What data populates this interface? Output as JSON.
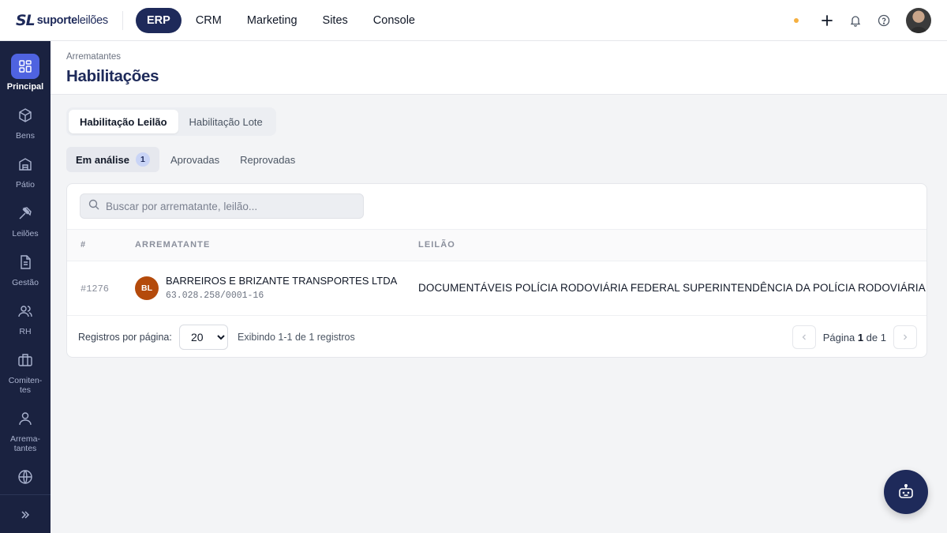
{
  "app": {
    "logo_mark": "SL",
    "logo_bold": "suporte",
    "logo_rest": "leilões"
  },
  "topnav": {
    "items": [
      {
        "label": "ERP",
        "active": true
      },
      {
        "label": "CRM"
      },
      {
        "label": "Marketing"
      },
      {
        "label": "Sites"
      },
      {
        "label": "Console"
      }
    ]
  },
  "sidebar": {
    "items": [
      {
        "label": "Principal",
        "icon": "grid-icon",
        "active": true
      },
      {
        "label": "Bens",
        "icon": "box-icon"
      },
      {
        "label": "Pátio",
        "icon": "warehouse-icon"
      },
      {
        "label": "Leilões",
        "icon": "gavel-icon"
      },
      {
        "label": "Gestão",
        "icon": "document-icon"
      },
      {
        "label": "RH",
        "icon": "users-icon"
      },
      {
        "label": "Comiten-\ntes",
        "icon": "briefcase-icon"
      },
      {
        "label": "Arrema-\ntantes",
        "icon": "user-icon"
      },
      {
        "label": "",
        "icon": "globe-icon"
      }
    ],
    "expand_icon": "chevrons-right-icon"
  },
  "header": {
    "breadcrumb": "Arrematantes",
    "title": "Habilitações"
  },
  "segment_tabs": [
    {
      "label": "Habilitação Leilão",
      "active": true
    },
    {
      "label": "Habilitação Lote"
    }
  ],
  "status_tabs": [
    {
      "label": "Em análise",
      "count": "1",
      "active": true
    },
    {
      "label": "Aprovadas"
    },
    {
      "label": "Reprovadas"
    }
  ],
  "search": {
    "placeholder": "Buscar por arrematante, leilão..."
  },
  "table": {
    "columns": [
      "#",
      "ARREMATANTE",
      "LEILÃO"
    ],
    "rows": [
      {
        "id": "#1276",
        "initials": "BL",
        "name": "BARREIROS E BRIZANTE TRANSPORTES LTDA",
        "document": "63.028.258/0001-16",
        "leilao": "DOCUMENTÁVEIS POLÍCIA RODOVIÁRIA FEDERAL SUPERINTENDÊNCIA DA POLÍCIA RODOVIÁRIA FEDERAL"
      }
    ]
  },
  "footer": {
    "per_page_label": "Registros por página:",
    "per_page_value": "20",
    "showing": "Exibindo 1-1 de 1 registros",
    "page_prefix": "Página",
    "page_current": "1",
    "page_of": "de",
    "page_total": "1"
  },
  "colors": {
    "navy": "#1e2a5a",
    "sidebar": "#1a2240",
    "active_blue": "#4f63e0",
    "avatar_orange": "#b44a0b",
    "status_dot": "#f5b041"
  }
}
